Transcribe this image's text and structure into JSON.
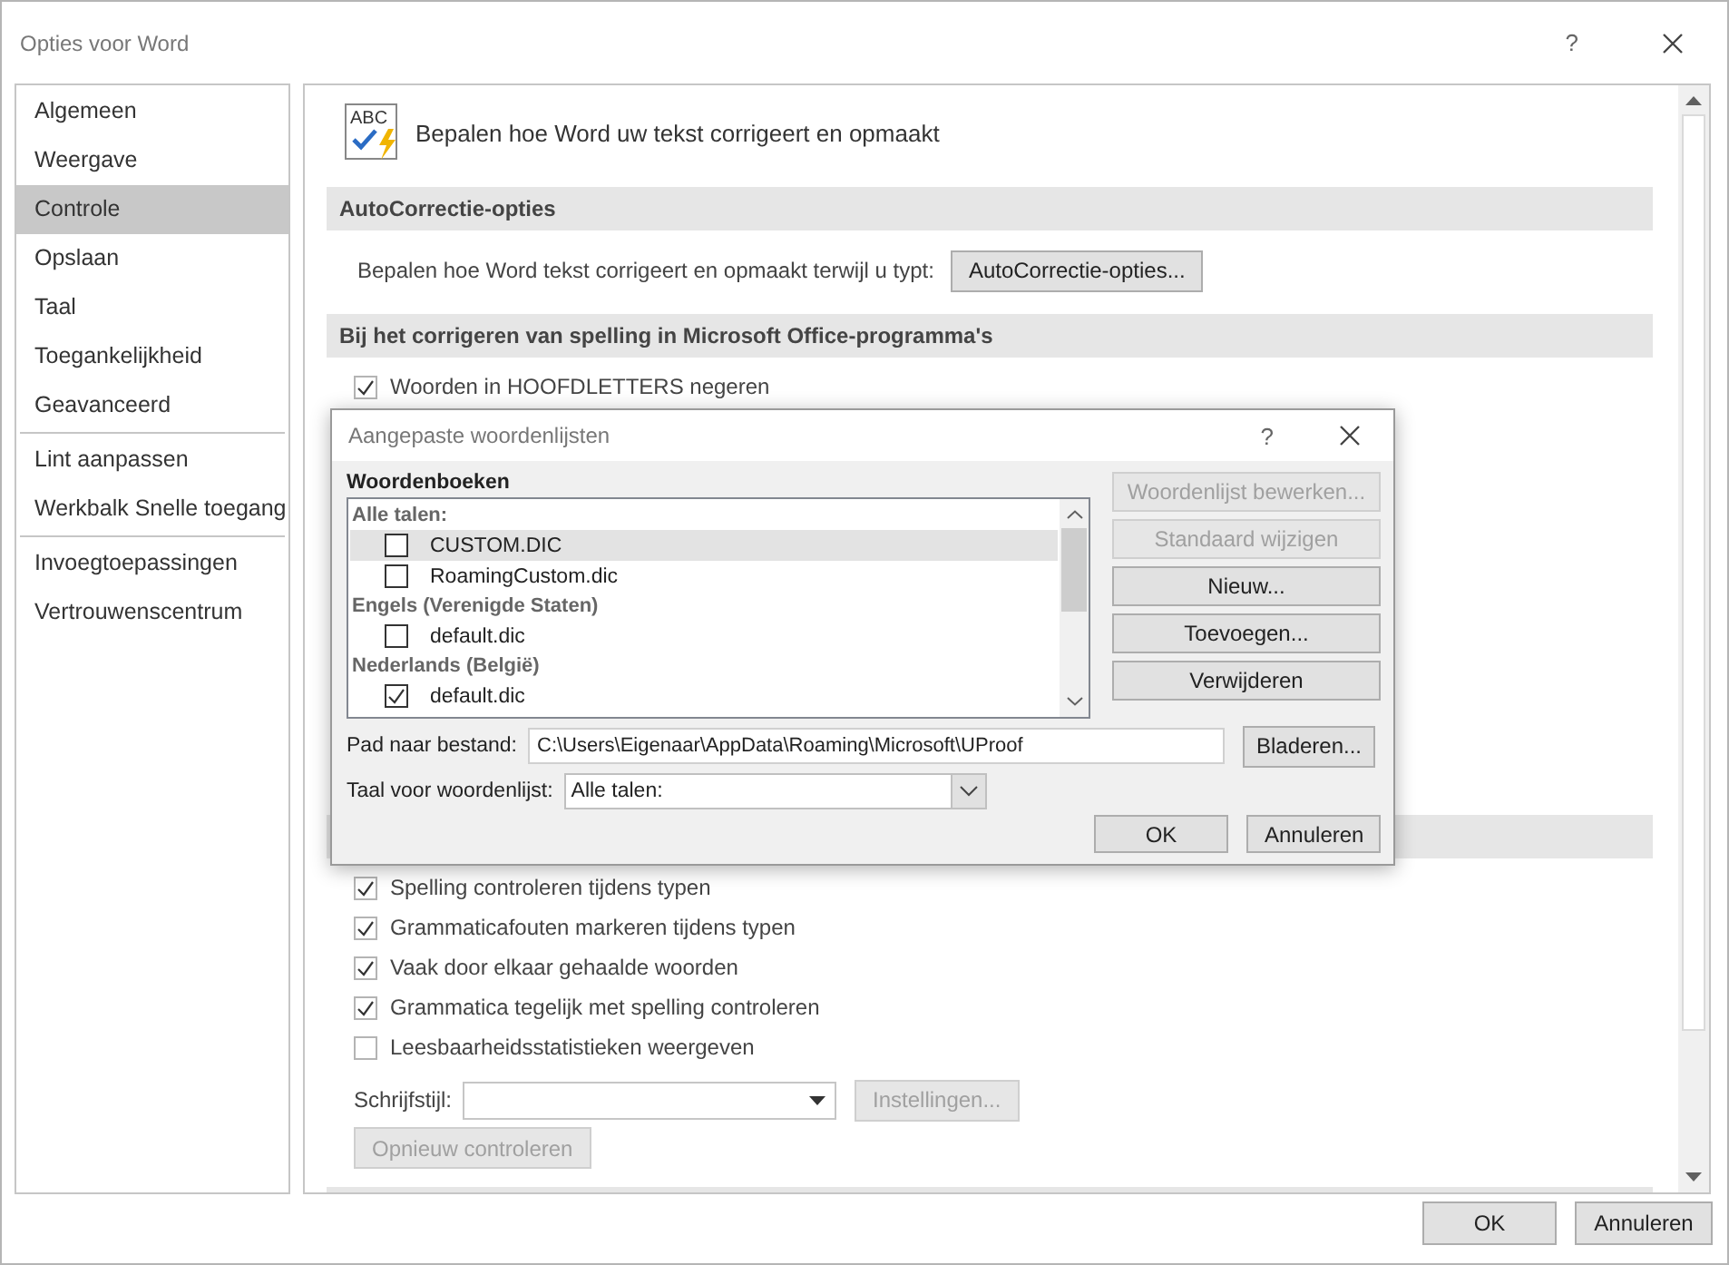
{
  "window": {
    "title": "Opties voor Word",
    "help": "?"
  },
  "sidebar": {
    "groups": [
      [
        {
          "label": "Algemeen",
          "selected": false
        },
        {
          "label": "Weergave",
          "selected": false
        },
        {
          "label": "Controle",
          "selected": true
        },
        {
          "label": "Opslaan",
          "selected": false
        },
        {
          "label": "Taal",
          "selected": false
        },
        {
          "label": "Toegankelijkheid",
          "selected": false
        },
        {
          "label": "Geavanceerd",
          "selected": false
        }
      ],
      [
        {
          "label": "Lint aanpassen",
          "selected": false
        },
        {
          "label": "Werkbalk Snelle toegang",
          "selected": false
        }
      ],
      [
        {
          "label": "Invoegtoepassingen",
          "selected": false
        },
        {
          "label": "Vertrouwenscentrum",
          "selected": false
        }
      ]
    ]
  },
  "page": {
    "icon_text": "ABC",
    "heading": "Bepalen hoe Word uw tekst corrigeert en opmaakt",
    "sections": [
      {
        "title": "AutoCorrectie-opties",
        "items": [
          {
            "kind": "button_row",
            "label": "Bepalen hoe Word tekst corrigeert en opmaakt terwijl u typt:",
            "button": "AutoCorrectie-opties...",
            "disabled": false
          }
        ]
      },
      {
        "title": "Bij het corrigeren van spelling in Microsoft Office-programma's",
        "items": [
          {
            "kind": "checkbox",
            "label": "Woorden in HOOFDLETTERS negeren",
            "checked": true
          }
        ]
      },
      {
        "items": [
          {
            "kind": "checkbox",
            "label": "Spelling controleren tijdens typen",
            "checked": true
          },
          {
            "kind": "checkbox",
            "label": "Grammaticafouten markeren tijdens typen",
            "checked": true
          },
          {
            "kind": "checkbox",
            "label": "Vaak door elkaar gehaalde woorden",
            "checked": true
          },
          {
            "kind": "checkbox",
            "label": "Grammatica tegelijk met spelling controleren",
            "checked": true
          },
          {
            "kind": "checkbox",
            "label": "Leesbaarheidsstatistieken weergeven",
            "checked": false
          },
          {
            "kind": "select_row",
            "label": "Schrijfstijl:",
            "button": "Instellingen...",
            "disabled": true
          },
          {
            "kind": "button",
            "label": "Opnieuw controleren",
            "disabled": true
          }
        ]
      }
    ]
  },
  "dialog": {
    "title": "Aangepaste woordenlijsten",
    "help": "?",
    "list_label": "Woordenboeken",
    "list": [
      {
        "kind": "group",
        "label": "Alle talen:"
      },
      {
        "kind": "file",
        "label": "CUSTOM.DIC",
        "checked": false,
        "selected": true
      },
      {
        "kind": "file",
        "label": "RoamingCustom.dic",
        "checked": false,
        "selected": false
      },
      {
        "kind": "group",
        "label": "Engels (Verenigde Staten)"
      },
      {
        "kind": "file",
        "label": "default.dic",
        "checked": false,
        "selected": false
      },
      {
        "kind": "group",
        "label": "Nederlands (België)"
      },
      {
        "kind": "file",
        "label": "default.dic",
        "checked": true,
        "selected": false
      }
    ],
    "side_buttons": [
      {
        "label": "Woordenlijst bewerken...",
        "disabled": true
      },
      {
        "label": "Standaard wijzigen",
        "disabled": true
      },
      {
        "label": "Nieuw...",
        "disabled": false
      },
      {
        "label": "Toevoegen...",
        "disabled": false
      },
      {
        "label": "Verwijderen",
        "disabled": false
      }
    ],
    "path_label": "Pad naar bestand:",
    "path": "C:\\Users\\Eigenaar\\AppData\\Roaming\\Microsoft\\UProof",
    "browse": "Bladeren...",
    "language_label": "Taal voor woordenlijst:",
    "language": "Alle talen:",
    "buttons": [
      "OK",
      "Annuleren"
    ]
  },
  "footer": {
    "buttons": [
      "OK",
      "Annuleren"
    ]
  }
}
